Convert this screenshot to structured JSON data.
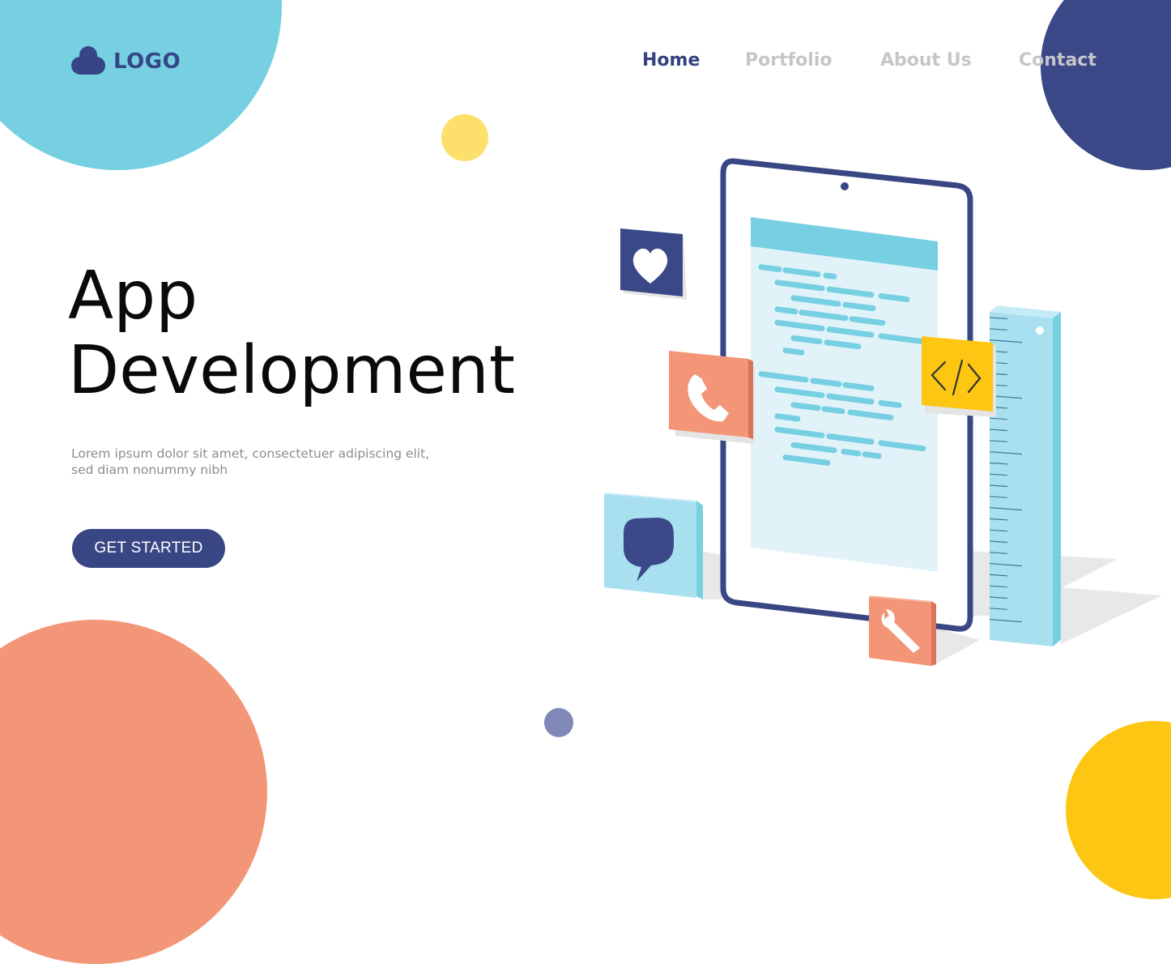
{
  "brand": {
    "logo_text": "LOGO",
    "logo_icon": "cloud-icon"
  },
  "nav": {
    "items": [
      {
        "label": "Home",
        "active": true
      },
      {
        "label": "Portfolio",
        "active": false
      },
      {
        "label": "About Us",
        "active": false
      },
      {
        "label": "Contact",
        "active": false
      }
    ]
  },
  "hero": {
    "title_line1": "App",
    "title_line2": "Development",
    "description": "Lorem ipsum dolor sit amet, consectetuer adipiscing elit, sed diam nonummy nibh",
    "cta_label": "GET STARTED"
  },
  "illustration": {
    "subject": "smartphone-with-code",
    "floating_tiles": [
      {
        "icon": "heart-icon",
        "color": "#3a4888"
      },
      {
        "icon": "phone-icon",
        "color": "#f39678"
      },
      {
        "icon": "code-icon",
        "glyph": "</>",
        "color": "#fcc613"
      },
      {
        "icon": "chat-bubble-icon",
        "color": "#a9e0ef"
      },
      {
        "icon": "wrench-icon",
        "color": "#f39678"
      }
    ],
    "ruler": "ruler-icon"
  },
  "colors": {
    "primary": "#384784",
    "accent_cyan": "#77cfe2",
    "accent_coral": "#f39678",
    "accent_yellow": "#fcc613",
    "nav_inactive": "#c6c6c9",
    "text_muted": "#8c8c8c"
  }
}
